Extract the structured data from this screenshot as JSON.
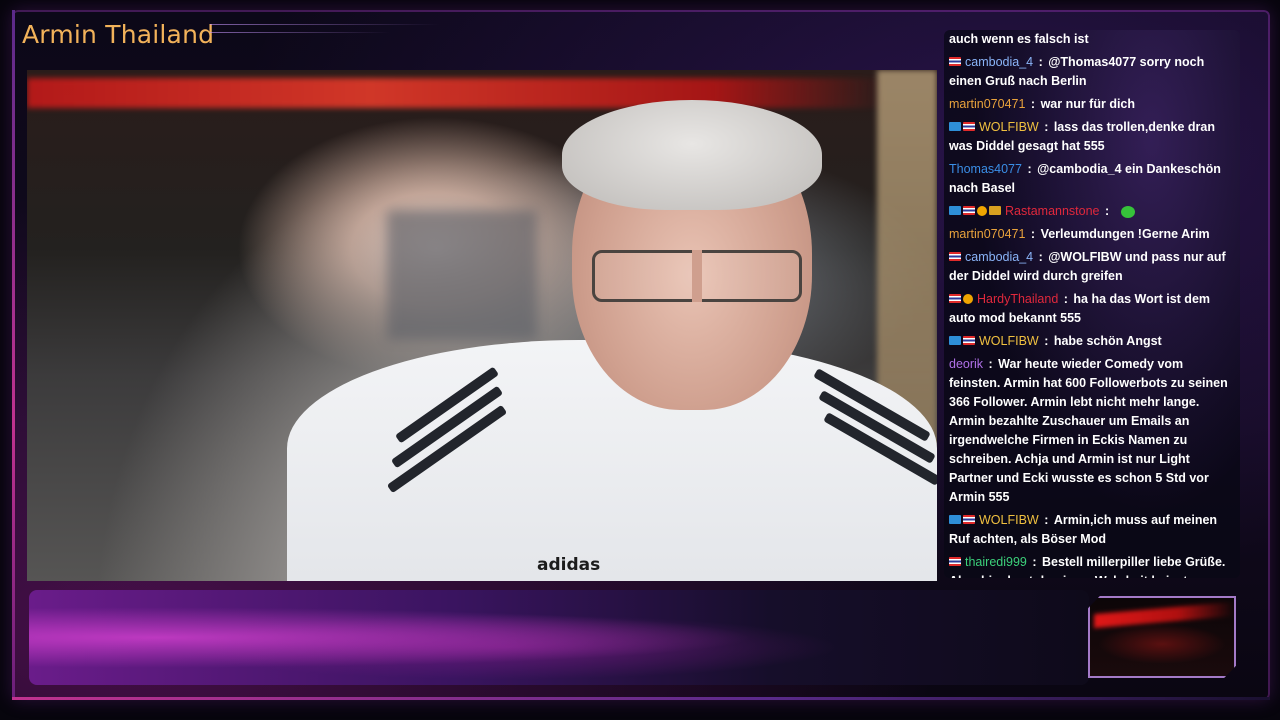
{
  "stream": {
    "title": "Armin Thailand"
  },
  "colors": {
    "title": "#f2b25a",
    "frame_accent": "#c0328f",
    "chat_text": "#ffffff"
  },
  "chat": {
    "messages": [
      {
        "user": "",
        "badges": [],
        "user_color": "#ffffff",
        "text": "auch wenn es falsch ist"
      },
      {
        "user": "cambodia_4",
        "badges": [
          "flag"
        ],
        "user_color": "#8ab4f8",
        "text": "@Thomas4077 sorry noch einen Gruß nach Berlin"
      },
      {
        "user": "martin070471",
        "badges": [],
        "user_color": "#e8a23c",
        "text": "war nur für dich"
      },
      {
        "user": "WOLFIBW",
        "badges": [
          "mod",
          "flag"
        ],
        "user_color": "#f0c040",
        "text": "lass das trollen,denke dran was Diddel gesagt hat 555"
      },
      {
        "user": "Thomas4077",
        "badges": [],
        "user_color": "#3a8ee6",
        "text": "@cambodia_4 ein Dankeschön nach Basel"
      },
      {
        "user": "Rastamannstone",
        "badges": [
          "mod",
          "flag",
          "vip",
          "crown"
        ],
        "user_color": "#e0283c",
        "text": "",
        "emote": "green-emote"
      },
      {
        "user": "martin070471",
        "badges": [],
        "user_color": "#e8a23c",
        "text": "Verleumdungen !Gerne Arim"
      },
      {
        "user": "cambodia_4",
        "badges": [
          "flag"
        ],
        "user_color": "#8ab4f8",
        "text": "@WOLFIBW und pass nur auf der Diddel wird durch greifen"
      },
      {
        "user": "HardyThailand",
        "badges": [
          "flag",
          "vip"
        ],
        "user_color": "#e0283c",
        "text": "ha ha das Wort ist dem auto mod bekannt 555"
      },
      {
        "user": "WOLFIBW",
        "badges": [
          "mod",
          "flag"
        ],
        "user_color": "#f0c040",
        "text": "habe schön Angst"
      },
      {
        "user": "deorik",
        "badges": [],
        "user_color": "#b070e8",
        "text": "War heute wieder Comedy vom feinsten. Armin hat 600 Followerbots zu seinen 366 Follower. Armin lebt nicht mehr lange. Armin bezahlte Zuschauer um Emails an irgendwelche Firmen in Eckis Namen zu schreiben. Achja und Armin ist nur Light Partner und Ecki wusste es schon 5 Std vor Armin 555"
      },
      {
        "user": "WOLFIBW",
        "badges": [
          "mod",
          "flag"
        ],
        "user_color": "#f0c040",
        "text": "Armin,ich muss auf meinen Ruf achten, als Böser Mod"
      },
      {
        "user": "thairedi999",
        "badges": [
          "flag"
        ],
        "user_color": "#3cd07a",
        "text": "Bestell millerpiller liebe Grüße. Aber hier hast du nix an Wahrheit beizutragen"
      }
    ]
  },
  "shirt": {
    "brand": "adidas"
  }
}
